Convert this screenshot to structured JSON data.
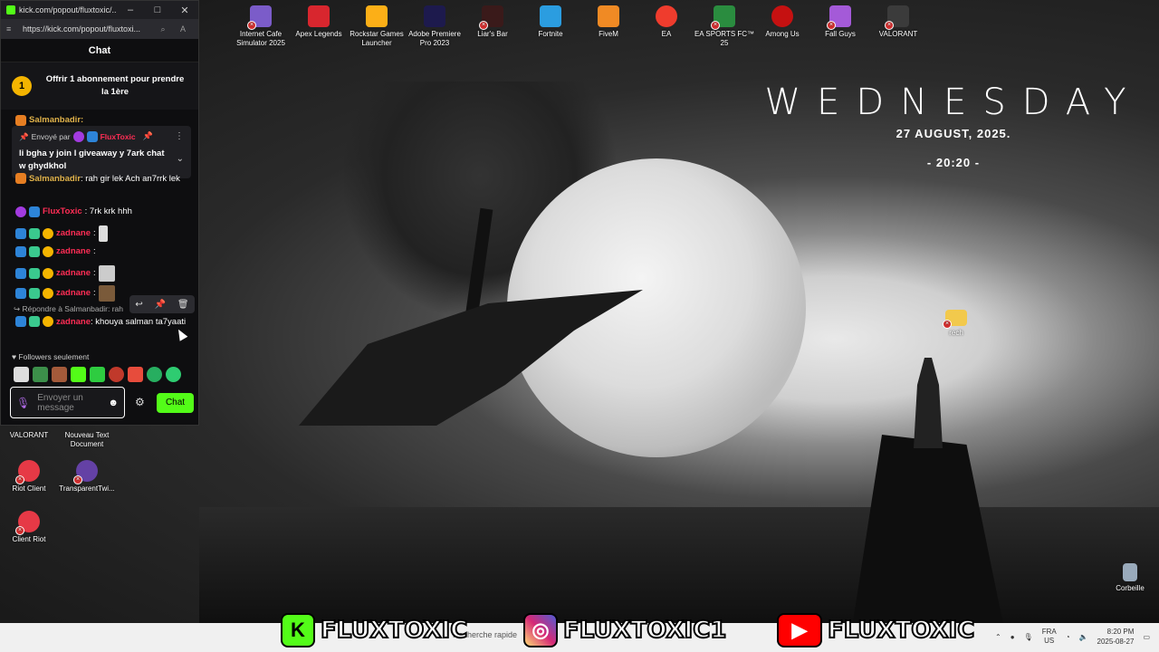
{
  "browser": {
    "title": "kick.com/popout/fluxtoxic/...",
    "url": "https://kick.com/popout/fluxtoxi..."
  },
  "chat": {
    "header": "Chat",
    "sub_offer_badge": "1",
    "sub_offer": "Offrir 1 abonnement pour prendre la 1ère",
    "pinned_prefix": "Envoyé par",
    "pinned_user": "FluxToxic",
    "pinned_text": "li bgha y join l giveaway y 7ark chat w ghydkhol",
    "top_user": "Salmanbadir:",
    "messages": [
      {
        "user": "Salmanbadir",
        "text": ": rah gir lek Ach an7rrk lek"
      },
      {
        "user": "FluxToxic",
        "text": ": 7rk krk hhh"
      },
      {
        "user": "zadnane",
        "text": ":"
      },
      {
        "user": "zadnane",
        "text": ":"
      },
      {
        "user": "zadnane",
        "text": ":"
      },
      {
        "user": "zadnane",
        "text": ":"
      },
      {
        "user": "zadnane",
        "text": ": khouya salman ta7yaati"
      }
    ],
    "reply_to": "Répondre à Salmanbadir: rah",
    "followers_only": "Followers seulement",
    "input_placeholder": "Envoyer un message",
    "send_label": "Chat"
  },
  "desktop": {
    "icons_top": [
      "Internet Cafe Simulator 2025",
      "Apex Legends",
      "Rockstar Games Launcher",
      "Adobe Premiere Pro 2023",
      "Liar's Bar",
      "Fortnite",
      "FiveM",
      "EA",
      "EA SPORTS FC™ 25",
      "Among Us",
      "Fall Guys",
      "VALORANT"
    ],
    "icons_left": [
      "VALORANT",
      "Nouveau Text Document",
      "Riot Client",
      "TransparentTwi...",
      "Client Riot"
    ],
    "icon_folder": "rech",
    "icon_bin": "Corbeille",
    "clock_day": "WEDNESDAY",
    "clock_date": "27 AUGUST, 2025.",
    "clock_time": "- 20:20 -"
  },
  "taskbar": {
    "search_placeholder": "Recherche rapide",
    "lang_top": "FRA",
    "lang_bottom": "US",
    "time": "8:20 PM",
    "date": "2025-08-27"
  },
  "overlay": {
    "kick_name": "FLUXTOXIC",
    "instagram_name": "FLUXTOXIC1",
    "youtube_name": "FLUXTOXIC"
  },
  "colors": {
    "kick_green": "#53fc18",
    "user_red": "#ff2d55"
  }
}
